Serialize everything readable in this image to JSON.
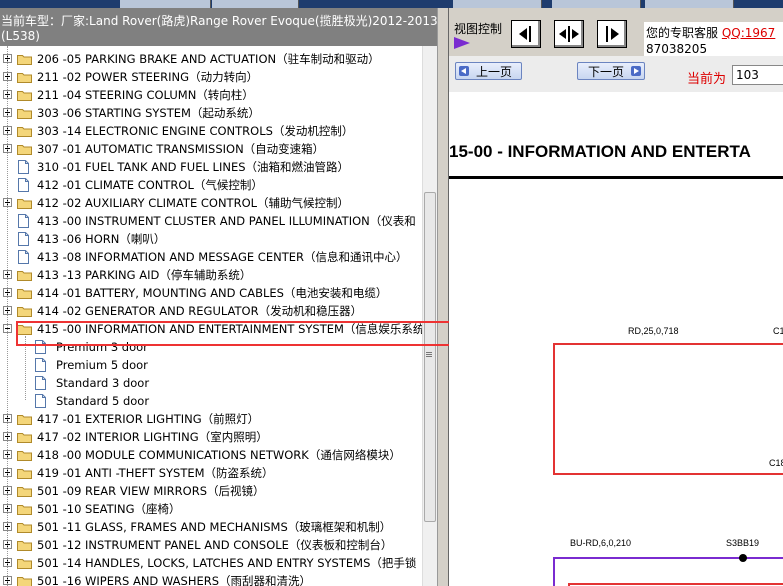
{
  "header": {
    "line1": "当前车型：厂家:Land Rover(路虎)Range Rover Evoque(揽胜极光)2012-2013",
    "line2": "(L538)"
  },
  "tree": [
    {
      "label": "206 -05 PARKING BRAKE AND ACTUATION（驻车制动和驱动）",
      "type": "folder",
      "toggle": "plus"
    },
    {
      "label": "211 -02 POWER STEERING（动力转向）",
      "type": "folder",
      "toggle": "plus"
    },
    {
      "label": "211 -04 STEERING COLUMN（转向柱）",
      "type": "folder",
      "toggle": "plus"
    },
    {
      "label": "303 -06 STARTING SYSTEM（起动系统）",
      "type": "folder",
      "toggle": "plus"
    },
    {
      "label": "303 -14 ELECTRONIC ENGINE CONTROLS（发动机控制）",
      "type": "folder",
      "toggle": "plus"
    },
    {
      "label": "307 -01 AUTOMATIC TRANSMISSION（自动变速箱）",
      "type": "folder",
      "toggle": "plus"
    },
    {
      "label": "310 -01 FUEL TANK AND FUEL LINES（油箱和燃油管路）",
      "type": "doc",
      "toggle": ""
    },
    {
      "label": "412 -01 CLIMATE CONTROL（气候控制）",
      "type": "doc",
      "toggle": ""
    },
    {
      "label": "412 -02 AUXILIARY CLIMATE CONTROL（辅助气候控制）",
      "type": "folder",
      "toggle": "plus"
    },
    {
      "label": "413 -00 INSTRUMENT CLUSTER AND PANEL ILLUMINATION（仪表和",
      "type": "doc",
      "toggle": ""
    },
    {
      "label": "413 -06 HORN（喇叭）",
      "type": "doc",
      "toggle": ""
    },
    {
      "label": "413 -08 INFORMATION AND MESSAGE CENTER（信息和通讯中心）",
      "type": "doc",
      "toggle": ""
    },
    {
      "label": "413 -13 PARKING AID（停车辅助系统）",
      "type": "folder",
      "toggle": "plus"
    },
    {
      "label": "414 -01 BATTERY, MOUNTING AND CABLES（电池安装和电缆）",
      "type": "folder",
      "toggle": "plus"
    },
    {
      "label": "414 -02 GENERATOR AND REGULATOR（发动机和稳压器）",
      "type": "folder",
      "toggle": "plus"
    },
    {
      "label": "415 -00 INFORMATION AND ENTERTAINMENT SYSTEM（信息娱乐系统",
      "type": "folder",
      "toggle": "minus",
      "selected": true
    },
    {
      "label": "Premium 3 door",
      "type": "doc",
      "toggle": "",
      "child": true
    },
    {
      "label": "Premium 5 door",
      "type": "doc",
      "toggle": "",
      "child": true
    },
    {
      "label": "Standard 3 door",
      "type": "doc",
      "toggle": "",
      "child": true
    },
    {
      "label": "Standard 5 door",
      "type": "doc",
      "toggle": "",
      "child": true
    },
    {
      "label": "417 -01 EXTERIOR LIGHTING（前照灯）",
      "type": "folder",
      "toggle": "plus"
    },
    {
      "label": "417 -02 INTERIOR LIGHTING（室内照明）",
      "type": "folder",
      "toggle": "plus"
    },
    {
      "label": "418 -00 MODULE COMMUNICATIONS NETWORK（通信网络模块）",
      "type": "folder",
      "toggle": "plus"
    },
    {
      "label": "419 -01 ANTI -THEFT SYSTEM（防盗系统）",
      "type": "folder",
      "toggle": "plus"
    },
    {
      "label": "501 -09 REAR VIEW MIRRORS（后视镜）",
      "type": "folder",
      "toggle": "plus"
    },
    {
      "label": "501 -10 SEATING（座椅）",
      "type": "folder",
      "toggle": "plus"
    },
    {
      "label": "501 -11 GLASS, FRAMES AND MECHANISMS（玻璃框架和机制）",
      "type": "folder",
      "toggle": "plus"
    },
    {
      "label": "501 -12 INSTRUMENT PANEL AND CONSOLE（仪表板和控制台）",
      "type": "folder",
      "toggle": "plus"
    },
    {
      "label": "501 -14 HANDLES, LOCKS, LATCHES AND ENTRY SYSTEMS（把手锁",
      "type": "folder",
      "toggle": "plus"
    },
    {
      "label": "501 -16 WIPERS AND WASHERS（雨刮器和清洗）",
      "type": "folder",
      "toggle": "plus"
    }
  ],
  "toolbar": {
    "view_control_label": "视图控制",
    "service_line1": "您的专职客服",
    "service_qq_label": "QQ:1967",
    "service_line2": "87038205"
  },
  "nav": {
    "prev_label": "上一页",
    "next_label": "下一页",
    "current_label": "当前为",
    "page_value": "103"
  },
  "document": {
    "title": "15-00 - INFORMATION AND ENTERTA",
    "wire1": "RD,25,0,718",
    "conn1": "C1",
    "conn1b": "C18",
    "wire2": "BU-RD,6,0,210",
    "splice": "S3BB19"
  },
  "colors": {
    "header_bg": "#808080",
    "highlight": "#e33333",
    "wire_red": "#e33333",
    "wire_purple": "#7a2bd0"
  }
}
